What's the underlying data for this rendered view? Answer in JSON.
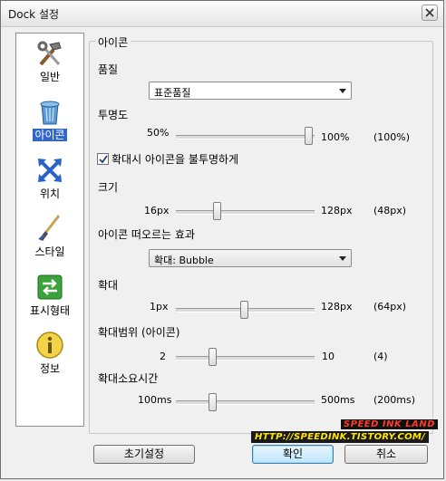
{
  "window": {
    "title": "Dock 설정"
  },
  "sidebar": {
    "items": [
      {
        "label": "일반",
        "icon": "tools-icon"
      },
      {
        "label": "아이콘",
        "icon": "recycle-bin-icon",
        "active": true
      },
      {
        "label": "위치",
        "icon": "arrows-icon"
      },
      {
        "label": "스타일",
        "icon": "brush-icon"
      },
      {
        "label": "표시형태",
        "icon": "swap-icon"
      },
      {
        "label": "정보",
        "icon": "info-icon"
      }
    ]
  },
  "panel": {
    "group_title": "아이콘",
    "quality": {
      "label": "품질",
      "value": "표준품질"
    },
    "opacity": {
      "label": "투명도",
      "min": "50%",
      "max": "100%",
      "value_text": "(100%)",
      "value": 100
    },
    "opaque_on_zoom": {
      "label": "확대시 아이콘을 불투명하게",
      "checked": true
    },
    "size": {
      "label": "크기",
      "min": "16px",
      "max": "128px",
      "value_text": "(48px)",
      "value": 48
    },
    "effect": {
      "label": "아이콘 떠오르는 효과",
      "value": "확대: Bubble"
    },
    "zoom": {
      "label": "확대",
      "min": "1px",
      "max": "128px",
      "value_text": "(64px)",
      "value": 64
    },
    "zoom_range": {
      "label": "확대범위 (아이콘)",
      "min": "2",
      "max": "10",
      "value_text": "(4)",
      "value": 4
    },
    "zoom_time": {
      "label": "확대소요시간",
      "min": "100ms",
      "max": "500ms",
      "value_text": "(200ms)",
      "value": 200
    }
  },
  "buttons": {
    "reset": "초기설정",
    "ok": "확인",
    "cancel": "취소"
  },
  "watermark": {
    "top": "SPEED INK LAND",
    "bottom": "HTTP://SPEEDINK.TISTORY.COM/"
  }
}
